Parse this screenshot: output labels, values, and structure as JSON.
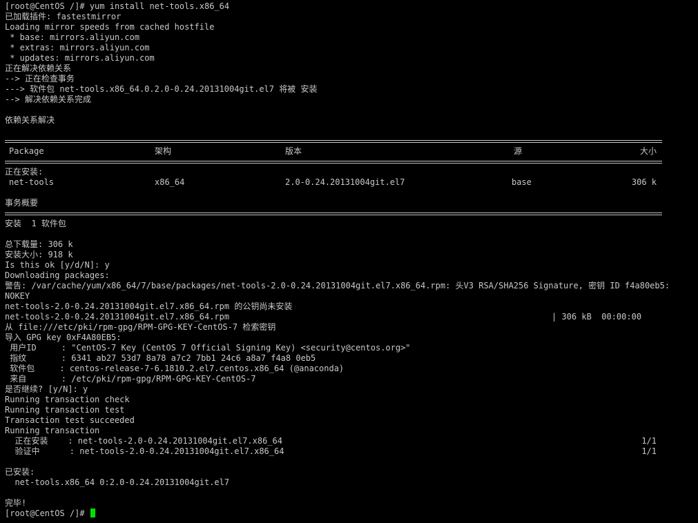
{
  "terminal": {
    "lines": [
      "[root@CentOS /]# yum install net-tools.x86_64",
      "已加载插件: fastestmirror",
      "Loading mirror speeds from cached hostfile",
      " * base: mirrors.aliyun.com",
      " * extras: mirrors.aliyun.com",
      " * updates: mirrors.aliyun.com",
      "正在解决依赖关系",
      "--> 正在检查事务",
      "---> 软件包 net-tools.x86_64.0.2.0-0.24.20131004git.el7 将被 安装",
      "--> 解决依赖关系完成",
      "",
      "依赖关系解决",
      ""
    ],
    "table_header": {
      "package": "Package",
      "arch": "架构",
      "version": "版本",
      "repo": "源",
      "size": "大小"
    },
    "installing_label": "正在安装:",
    "package_row": {
      "package": "net-tools",
      "arch": "x86_64",
      "version": "2.0-0.24.20131004git.el7",
      "repo": "base",
      "size": "306 k"
    },
    "summary_title": "事务概要",
    "lines2": [
      "安装  1 软件包",
      "",
      "总下载量: 306 k",
      "安装大小: 918 k",
      "Is this ok [y/d/N]: y",
      "Downloading packages:",
      "警告: /var/cache/yum/x86_64/7/base/packages/net-tools-2.0-0.24.20131004git.el7.x86_64.rpm: 头V3 RSA/SHA256 Signature, 密钥 ID f4a80eb5:",
      "NOKEY",
      "net-tools-2.0-0.24.20131004git.el7.x86_64.rpm 的公钥尚未安装"
    ],
    "download": {
      "file": "net-tools-2.0-0.24.20131004git.el7.x86_64.rpm",
      "stats": "| 306 kB  00:00:00"
    },
    "lines3": [
      "从 file:///etc/pki/rpm-gpg/RPM-GPG-KEY-CentOS-7 检索密钥",
      "导入 GPG key 0xF4A80EB5:",
      " 用户ID     : \"CentOS-7 Key (CentOS 7 Official Signing Key) <security@centos.org>\"",
      " 指纹       : 6341 ab27 53d7 8a78 a7c2 7bb1 24c6 a8a7 f4a8 0eb5",
      " 软件包     : centos-release-7-6.1810.2.el7.centos.x86_64 (@anaconda)",
      " 来自       : /etc/pki/rpm-gpg/RPM-GPG-KEY-CentOS-7",
      "是否继续? [y/N]: y",
      "Running transaction check",
      "Running transaction test",
      "Transaction test succeeded",
      "Running transaction"
    ],
    "transaction_rows": [
      {
        "label": "  正在安装    : net-tools-2.0-0.24.20131004git.el7.x86_64",
        "count": "1/1"
      },
      {
        "label": "  验证中      : net-tools-2.0-0.24.20131004git.el7.x86_64",
        "count": "1/1"
      }
    ],
    "lines4": [
      "",
      "已安装:",
      "  net-tools.x86_64 0:2.0-0.24.20131004git.el7",
      "",
      "完毕!"
    ],
    "prompt": "[root@CentOS /]# ",
    "cursor_color": "#00e000",
    "background_color": "#000000",
    "text_color": "#c8c8c8"
  }
}
